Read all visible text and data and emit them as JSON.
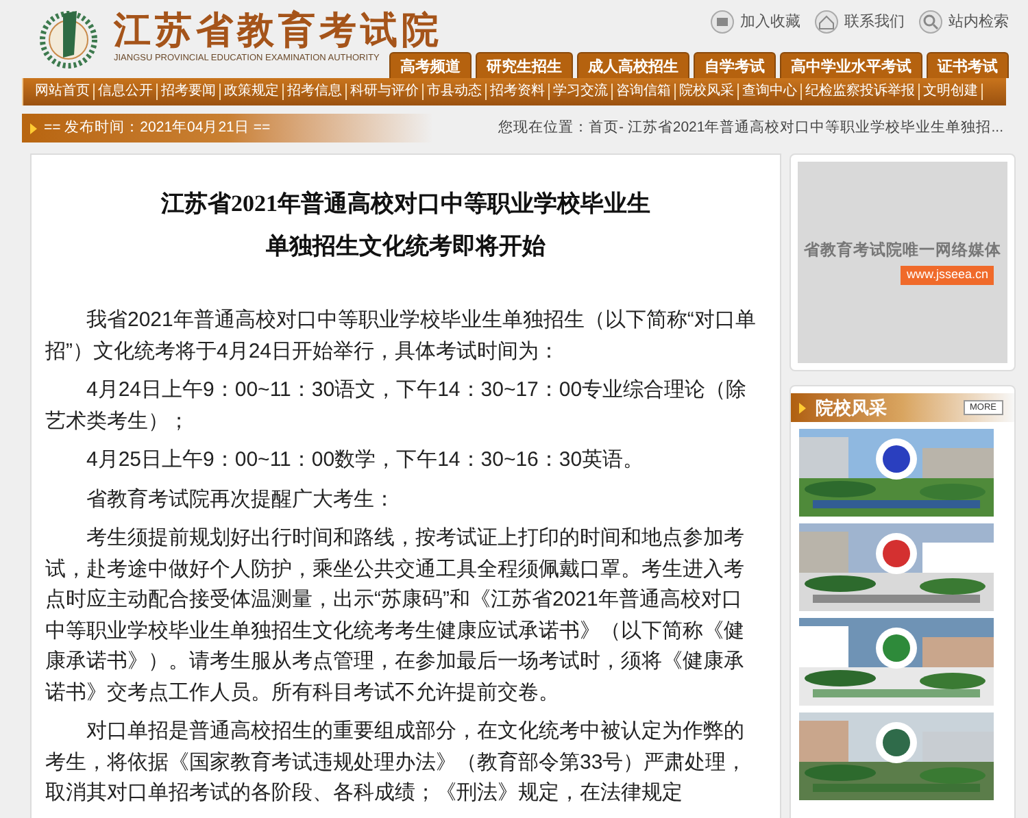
{
  "header": {
    "logo_title": "江苏省教育考试院",
    "logo_subtitle": "JIANGSU PROVINCIAL EDUCATION EXAMINATION AUTHORITY",
    "utility_links": [
      "加入收藏",
      "联系我们",
      "站内检索"
    ],
    "channel_tabs": [
      "高考频道",
      "研究生招生",
      "成人高校招生",
      "自学考试",
      "高中学业水平考试",
      "证书考试"
    ]
  },
  "nav": [
    "网站首页",
    "信息公开",
    "招考要闻",
    "政策规定",
    "招考信息",
    "科研与评价",
    "市县动态",
    "招考资料",
    "学习交流",
    "咨询信箱",
    "院校风采",
    "查询中心",
    "纪检监察投诉举报",
    "文明创建"
  ],
  "publish_bar": {
    "text": "== 发布时间：2021年04月21日 ==",
    "breadcrumb": "您现在位置：首页- 江苏省2021年普通高校对口中等职业学校毕业生单独招..."
  },
  "article": {
    "title_lines": [
      "江苏省2021年普通高校对口中等职业学校毕业生",
      "单独招生文化统考即将开始"
    ],
    "paragraphs": [
      "我省2021年普通高校对口中等职业学校毕业生单独招生（以下简称“对口单招”）文化统考将于4月24日开始举行，具体考试时间为：",
      "4月24日上午9：00~11：30语文，下午14：30~17：00专业综合理论（除艺术类考生）；",
      "4月25日上午9：00~11：00数学，下午14：30~16：30英语。",
      "省教育考试院再次提醒广大考生：",
      "考生须提前规划好出行时间和路线，按考试证上打印的时间和地点参加考试，赴考途中做好个人防护，乘坐公共交通工具全程须佩戴口罩。考生进入考点时应主动配合接受体温测量，出示“苏康码”和《江苏省2021年普通高校对口中等职业学校毕业生单独招生文化统考考生健康应试承诺书》（以下简称《健康承诺书》）。请考生服从考点管理，在参加最后一场考试时，须将《健康承诺书》交考点工作人员。所有科目考试不允许提前交卷。",
      "对口单招是普通高校招生的重要组成部分，在文化统考中被认定为作弊的考生，将依据《国家教育考试违规处理办法》（教育部令第33号）严肃处理，取消其对口单招考试的各阶段、各科成绩；《刑法》规定，在法律规定"
    ]
  },
  "sidebar": {
    "banner": {
      "slogan": "省教育考试院唯一网络媒体",
      "url": "www.jsseea.cn"
    },
    "college_section": {
      "title": "院校风采",
      "more": "MORE"
    }
  }
}
